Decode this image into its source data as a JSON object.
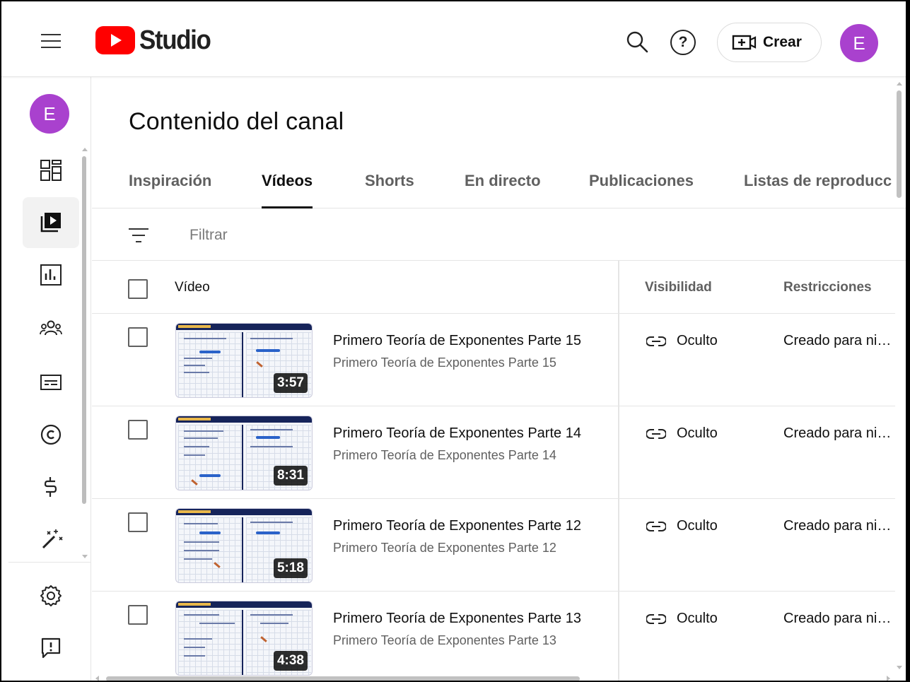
{
  "header": {
    "logo_text": "Studio",
    "help_glyph": "?",
    "create_label": "Crear",
    "avatar_initial": "E"
  },
  "sidebar": {
    "avatar_initial": "E",
    "items": [
      {
        "name": "dashboard-icon",
        "active": false
      },
      {
        "name": "content-icon",
        "active": true
      },
      {
        "name": "analytics-icon",
        "active": false
      },
      {
        "name": "community-icon",
        "active": false
      },
      {
        "name": "subtitles-icon",
        "active": false
      },
      {
        "name": "copyright-icon",
        "active": false
      },
      {
        "name": "earn-icon",
        "active": false
      },
      {
        "name": "customization-icon",
        "active": false
      },
      {
        "name": "settings-icon",
        "active": false
      },
      {
        "name": "feedback-icon",
        "active": false
      }
    ]
  },
  "page": {
    "title": "Contenido del canal",
    "tabs": [
      {
        "label": "Inspiración"
      },
      {
        "label": "Vídeos",
        "active": true
      },
      {
        "label": "Shorts"
      },
      {
        "label": "En directo"
      },
      {
        "label": "Publicaciones"
      },
      {
        "label": "Listas de reproducc"
      }
    ],
    "filter_placeholder": "Filtrar"
  },
  "table": {
    "headers": {
      "video": "Vídeo",
      "visibility": "Visibilidad",
      "restrictions": "Restricciones"
    },
    "rows": [
      {
        "title": "Primero Teoría de Exponentes Parte 15",
        "description": "Primero Teoría de Exponentes Parte 15",
        "duration": "3:57",
        "visibility": "Oculto",
        "restriction": "Creado para niñ..."
      },
      {
        "title": "Primero Teoría de Exponentes Parte 14",
        "description": "Primero Teoría de Exponentes Parte 14",
        "duration": "8:31",
        "visibility": "Oculto",
        "restriction": "Creado para niñ..."
      },
      {
        "title": "Primero Teoría de Exponentes Parte 12",
        "description": "Primero Teoría de Exponentes Parte 12",
        "duration": "5:18",
        "visibility": "Oculto",
        "restriction": "Creado para niñ..."
      },
      {
        "title": "Primero Teoría de Exponentes Parte 13",
        "description": "Primero Teoría de Exponentes Parte 13",
        "duration": "4:38",
        "visibility": "Oculto",
        "restriction": "Creado para niñ..."
      }
    ]
  },
  "colors": {
    "brand_red": "#ff0000",
    "avatar_purple": "#a941ce"
  }
}
